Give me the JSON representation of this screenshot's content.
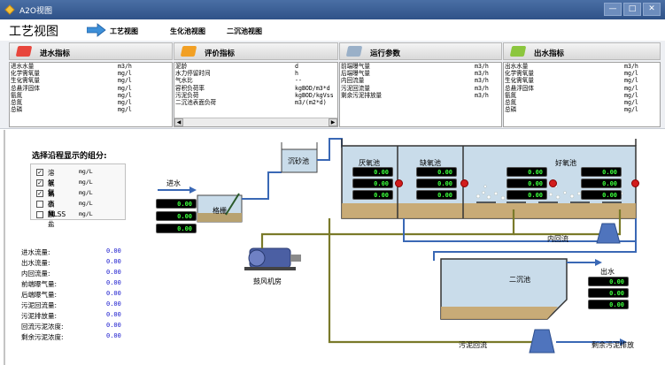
{
  "window": {
    "title": "A2O视图",
    "controls": {
      "minimize": "—",
      "maximize": "□",
      "close": "✕"
    }
  },
  "toolbar": {
    "page_title": "工艺视图",
    "views": [
      {
        "label": "工艺视图"
      },
      {
        "label": "生化池视图"
      },
      {
        "label": "二沉池视图"
      }
    ]
  },
  "panels": [
    {
      "title": "进水指标",
      "tag_color": "#e8463c",
      "rows": [
        {
          "name": "进水水量",
          "unit": "m3/h"
        },
        {
          "name": "化学需氧量",
          "unit": "mg/l"
        },
        {
          "name": "生化需氧量",
          "unit": "mg/l"
        },
        {
          "name": "总悬浮固体",
          "unit": "mg/l"
        },
        {
          "name": "氨氮",
          "unit": "mg/l"
        },
        {
          "name": "总氮",
          "unit": "mg/l"
        },
        {
          "name": "总磷",
          "unit": "mg/l"
        }
      ]
    },
    {
      "title": "评价指标",
      "tag_color": "#f2a024",
      "rows": [
        {
          "name": "泥龄",
          "unit": "d"
        },
        {
          "name": "水力停留时间",
          "unit": "h"
        },
        {
          "name": "气水比",
          "unit": "--"
        },
        {
          "name": "容积负荷率",
          "unit": "kgBOD/m3*d"
        },
        {
          "name": "污泥负荷",
          "unit": "kgBOD/kgVss"
        },
        {
          "name": "二沉池表面负荷",
          "unit": "m3/(m2*d)"
        }
      ],
      "scroll_left": "◀",
      "scroll_right": "▶"
    },
    {
      "title": "运行参数",
      "tag_color": "#9ab0c8",
      "rows": [
        {
          "name": "前端曝气量",
          "unit": "m3/h"
        },
        {
          "name": "后端曝气量",
          "unit": "m3/h"
        },
        {
          "name": "内回流量",
          "unit": "m3/h"
        },
        {
          "name": "污泥回流量",
          "unit": "m3/h"
        },
        {
          "name": "剩余污泥排放量",
          "unit": "m3/h"
        }
      ]
    },
    {
      "title": "出水指标",
      "tag_color": "#8cc63e",
      "rows": [
        {
          "name": "出水水量",
          "unit": "m3/h"
        },
        {
          "name": "化学需氧量",
          "unit": "mg/l"
        },
        {
          "name": "生化需氧量",
          "unit": "mg/l"
        },
        {
          "name": "总悬浮固体",
          "unit": "mg/l"
        },
        {
          "name": "氨氮",
          "unit": "mg/l"
        },
        {
          "name": "总氮",
          "unit": "mg/l"
        },
        {
          "name": "总磷",
          "unit": "mg/l"
        }
      ]
    }
  ],
  "components": {
    "title": "选择沿程显示的组分:",
    "items": [
      {
        "name": "溶解氧",
        "unit": "mg/L",
        "checked": true,
        "mark": "✓"
      },
      {
        "name": "氨氮",
        "unit": "mg/L",
        "checked": true,
        "mark": "✓"
      },
      {
        "name": "硝态氮",
        "unit": "mg/L",
        "checked": true,
        "mark": "✓"
      },
      {
        "name": "磷酸盐",
        "unit": "mg/L",
        "checked": false,
        "mark": ""
      },
      {
        "name": "MLSS",
        "unit": "mg/L",
        "checked": false,
        "mark": ""
      }
    ]
  },
  "flows": [
    {
      "label": "进水流量:",
      "value": "0.00"
    },
    {
      "label": "出水流量:",
      "value": "0.00"
    },
    {
      "label": "内回流量:",
      "value": "0.00"
    },
    {
      "label": "前端曝气量:",
      "value": "0.00"
    },
    {
      "label": "后端曝气量:",
      "value": "0.00"
    },
    {
      "label": "污泥回流量:",
      "value": "0.00"
    },
    {
      "label": "污泥排放量:",
      "value": "0.00"
    },
    {
      "label": "回流污泥浓度:",
      "value": "0.00"
    },
    {
      "label": "剩余污泥浓度:",
      "value": "0.00"
    }
  ],
  "diagram": {
    "inflow_label": "进水",
    "grit_label": "格栅",
    "sand_label": "沉砂池",
    "anaerobic_label": "厌氧池",
    "anoxic_label": "缺氧池",
    "aerobic_label": "好氧池",
    "clarifier_label": "二沉池",
    "blower_label": "鼓风机房",
    "internal_reflux_label": "内回流",
    "effluent_label": "出水",
    "sludge_return_label": "污泥回流",
    "sludge_discharge_label": "剩余污泥排放",
    "readings": {
      "inflow": [
        "0.00",
        "0.00",
        "0.00"
      ],
      "anaerobic": [
        "0.00",
        "0.00",
        "0.00"
      ],
      "anoxic": [
        "0.00",
        "0.00",
        "0.00"
      ],
      "aerobic_left": [
        "0.00",
        "0.00",
        "0.00"
      ],
      "aerobic_right": [
        "0.00",
        "0.00",
        "0.00"
      ],
      "effluent": [
        "0.00",
        "0.00",
        "0.00"
      ]
    }
  },
  "colors": {
    "title_bar": "#2f5288",
    "water": "#c9dcea",
    "sludge": "#c8a56a",
    "pipe_blue": "#3a68b5",
    "pipe_olive": "#7a7a2a",
    "lcd_text": "#3cff3c",
    "flow_value": "#1414cc"
  }
}
